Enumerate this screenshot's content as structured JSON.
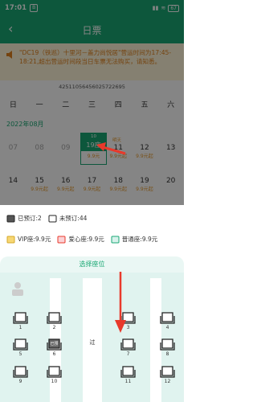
{
  "status": {
    "time": "17:01",
    "tag": "B",
    "battery": "67"
  },
  "header": {
    "title": "日票",
    "back": "‹"
  },
  "notice": {
    "text": "\"DC19（铁巡）十里河－盖力尚悦居\"营运时间为17:45-18:21,超出营运时间段当日车票无法购买，请知悉。"
  },
  "card_no": "42511056456025722695",
  "calendar": {
    "weekdays": [
      "日",
      "一",
      "二",
      "三",
      "四",
      "五",
      "六"
    ],
    "month": "2022年08月",
    "rows": [
      {
        "days": [
          "07",
          "08",
          "09",
          "10",
          "11",
          "12",
          "13"
        ],
        "prices": [
          "",
          "",
          "",
          "",
          "9.9元起",
          "9.9元起",
          ""
        ]
      },
      {
        "days": [
          "14",
          "15",
          "16",
          "17",
          "18",
          "19",
          "20"
        ],
        "prices": [
          "",
          "9.9元起",
          "9.9元起",
          "9.9元起",
          "9.9元起",
          "9.9元起",
          ""
        ]
      }
    ],
    "selected": {
      "top": "10",
      "mid": "19座",
      "bottom": "9.9元"
    },
    "mini_tag": "明天"
  },
  "legend": {
    "booked": "已预订:2",
    "unbooked": "未预订:44",
    "vip": "VIP座:9.9元",
    "love": "爱心座:9.9元",
    "normal": "普通座:9.9元"
  },
  "seat_section": {
    "title": "选择座位",
    "aisle": "过"
  },
  "seats": [
    {
      "n": "1"
    },
    {
      "n": "2"
    },
    {
      "n": "3"
    },
    {
      "n": "4"
    },
    {
      "n": "5"
    },
    {
      "n": "6",
      "label": "已预"
    },
    {
      "n": "7"
    },
    {
      "n": "8"
    },
    {
      "n": "9"
    },
    {
      "n": "10"
    },
    {
      "n": "11"
    },
    {
      "n": "12"
    }
  ],
  "colors": {
    "primary": "#1aa874",
    "accent": "#e69a2d",
    "arrow": "#e8392b"
  }
}
